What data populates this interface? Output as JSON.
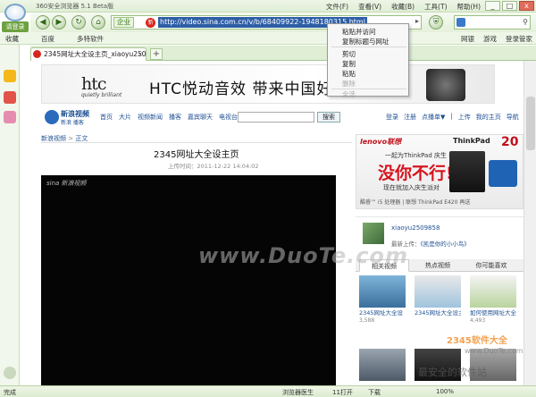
{
  "window": {
    "title": "360安全浏览器 5.1 Beta版",
    "menu": [
      "文件(F)",
      "查看(V)",
      "收藏(B)",
      "工具(T)",
      "帮助(H)"
    ],
    "controls": [
      "_",
      "□",
      "x"
    ]
  },
  "login_label": "请登录",
  "address_bar": {
    "mode": "企业",
    "url": "http://video.sina.com.cn/v/b/68409922-1948180315.html",
    "search_icon": "search-icon"
  },
  "favorites_bar": {
    "items": [
      "收藏",
      "百度",
      "多特软件"
    ],
    "right_items": [
      "网银",
      "游戏",
      "登录管家"
    ]
  },
  "tab": {
    "title": "2345网址大全设主页_xiaoyu2509858..."
  },
  "banner": {
    "brand": "htc",
    "tagline": "quietly brilliant",
    "slogan": "HTC悦动音效   带来中国好声"
  },
  "sina": {
    "logo_main": "新浪视频",
    "logo_sub": "新浪 播客",
    "nav": [
      "首页",
      "大片",
      "视频新闻",
      "播客",
      "嘉宾聊天",
      "电视台"
    ],
    "search_button": "搜索",
    "right": [
      "登录",
      "注册",
      "点播单▼",
      "|",
      "上传",
      "我的主页",
      "导航"
    ]
  },
  "breadcrumb": [
    "新浪视频",
    "正文"
  ],
  "video": {
    "title": "2345网址大全设主页",
    "meta": "上传时间：2011-12-22 14:04:02",
    "watermark": "sina 新浪视频"
  },
  "ad": {
    "brand": "lenovo联想",
    "model": "ThinkPad",
    "badge": "20",
    "line1": "一起为ThinkPad 庆生 收到",
    "headline": "没你不行!",
    "line3": "现在就加入庆生派对",
    "line4": "酷睿™ i5 处理器 | 联想 ThinkPad E420 再送"
  },
  "uploader": {
    "name": "xiaoyu2509858",
    "last_label": "最新上传：",
    "last_video": "《凯是你的小小鸟》"
  },
  "right_tabs": [
    "相关视频",
    "热点视频",
    "你可能喜欢"
  ],
  "thumbs": [
    {
      "caption": "2345网址大全设",
      "count": "3,588"
    },
    {
      "caption": "2345网址大全设主页用",
      "count": ""
    },
    {
      "caption": "如何使用网址大全",
      "count": "4,493"
    }
  ],
  "context_menu": {
    "items": [
      "粘贴并访问",
      "复制标题与网址",
      "剪切",
      "复制",
      "粘贴",
      "删除",
      "全选"
    ],
    "disabled": [
      "删除",
      "全选"
    ]
  },
  "status_bar": {
    "left": "完成",
    "items": [
      "浏览器医生",
      "11打开",
      "下载",
      "100%"
    ]
  },
  "watermarks": {
    "center": "www.DuoTe.com",
    "corner_brand": "2345软件大全",
    "corner_url": "www.DuoTe.com",
    "corner_text": "最安全的软件站"
  },
  "colors": {
    "chrome_green": "#dfeed5",
    "url_highlight": "#2d5ea6",
    "sina_blue": "#1d4f93",
    "ad_red": "#d7131d"
  }
}
